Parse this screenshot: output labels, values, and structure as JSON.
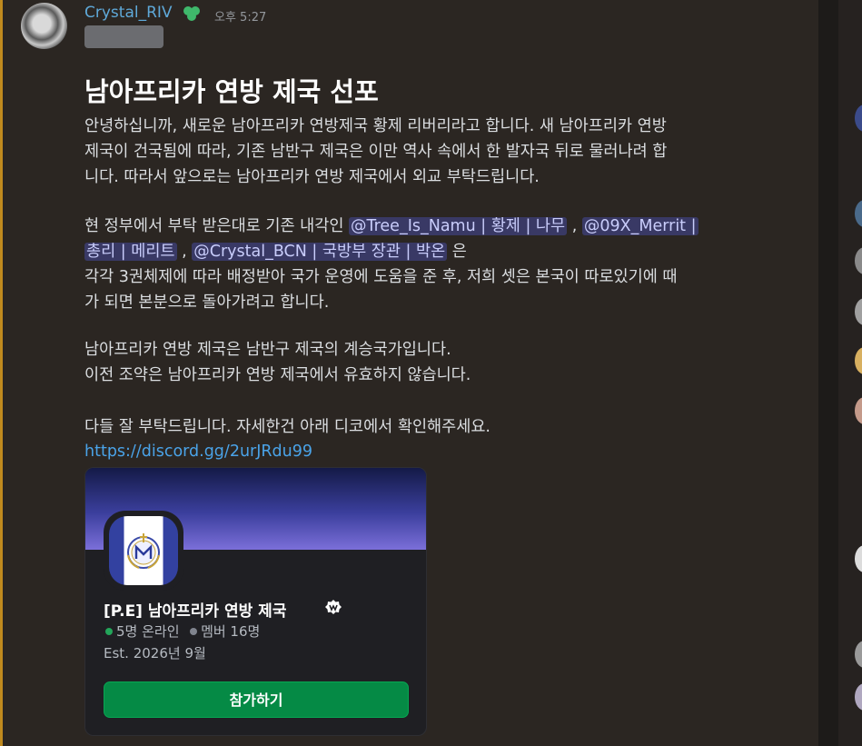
{
  "message": {
    "author": "Crystal_RIV",
    "time": "오후 5:27",
    "title": "남아프리카 연방 제국 선포",
    "para1": [
      "안녕하십니까, 새로운 남아프리카 연방제국 황제 리버리라고 합니다. 새 남아프리카 연방",
      "제국이 건국됨에 따라, 기존 남반구 제국은 이만 역사 속에서 한 발자국 뒤로 물러나려 합",
      "니다. 따라서 앞으로는 남아프리카 연방 제국에서 외교 부탁드립니다."
    ],
    "para2": {
      "line1_prefix": "현 정부에서 부탁 받은대로 기존 내각인 ",
      "mention1": "@Tree_Is_Namu | 황제 | 나무",
      "sep": ",",
      "mention2a": "@09X_Merrit |",
      "mention2b": "총리 | 메리트",
      "mention3": "@Crystal_BCN | 국방부 장관 | 박온",
      "suffix": " 은",
      "line3": "각각 3권체제에 따라 배정받아 국가 운영에 도움을 준 후, 저희 셋은 본국이 따로있기에 때",
      "line4": "가 되면 본분으로 돌아가려고 합니다."
    },
    "para3": [
      "남아프리카 연방 제국은 남반구 제국의 계승국가입니다.",
      "이전 조약은 남아프리카 연방 제국에서 유효하지 않습니다."
    ],
    "para4": "다들 잘 부탁드립니다. 자세한건 아래 디코에서 확인해주세요.",
    "link": "https://discord.gg/2urJRdu99"
  },
  "invite": {
    "server_name": "[P.E] 남아프리카 연방 제국",
    "online": "5명 온라인",
    "members": "멤버 16명",
    "established": "Est. 2026년 9월",
    "join_label": "참가하기",
    "online_color": "#23a55a",
    "member_color": "#80848e"
  },
  "colors": {
    "accent_highlight": "#c08a1e",
    "author": "#5fa9d9",
    "mention_bg": "#3b3f78",
    "join_button": "#058a45"
  }
}
